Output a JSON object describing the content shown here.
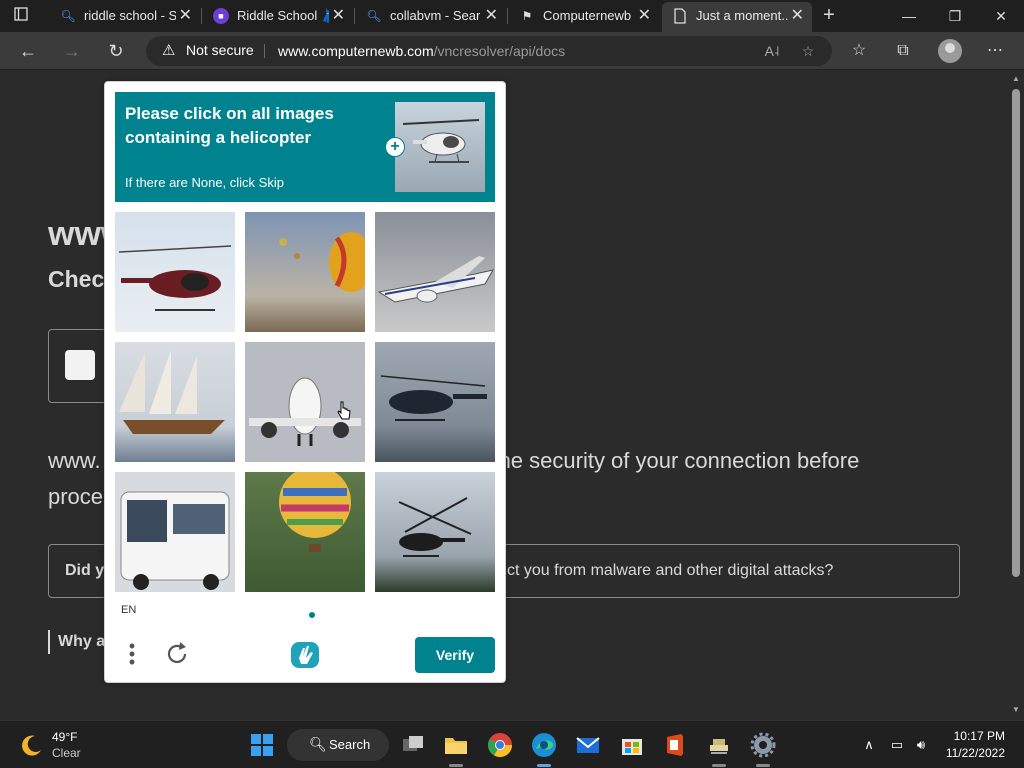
{
  "browser": {
    "tabs": [
      {
        "label": "riddle school - S",
        "icon": "search-icon"
      },
      {
        "label": "Riddle School 👗",
        "icon": "twitch-icon"
      },
      {
        "label": "collabvm - Sear",
        "icon": "search-icon"
      },
      {
        "label": "Computernewb",
        "icon": "computernewb-icon"
      },
      {
        "label": "Just a moment...",
        "icon": "page-icon"
      }
    ],
    "security_label": "Not secure",
    "url_host": "www.computernewb.com",
    "url_path": "/vncresolver/api/docs"
  },
  "page": {
    "site_title": "www.",
    "check_text": "Check",
    "body_start": "www.",
    "body_mid": "he security of your connection before",
    "body_end": "proce",
    "info_question": "Did y",
    "info_tail": "ct you from malware and other digital attacks?",
    "why_label": "Why a"
  },
  "captcha": {
    "prompt_line": "Please click on all images containing a helicopter",
    "prompt_sub": "If there are None, click Skip",
    "language": "EN",
    "verify_label": "Verify",
    "images": [
      {
        "subject": "helicopter"
      },
      {
        "subject": "hot-air-balloon"
      },
      {
        "subject": "airplane"
      },
      {
        "subject": "sailboat"
      },
      {
        "subject": "airplane"
      },
      {
        "subject": "helicopter"
      },
      {
        "subject": "bus"
      },
      {
        "subject": "hot-air-balloon"
      },
      {
        "subject": "helicopter"
      }
    ],
    "accent_color": "#00838f"
  },
  "taskbar": {
    "temperature": "49°F",
    "condition": "Clear",
    "search_label": "Search",
    "time": "10:17 PM",
    "date": "11/22/2022"
  }
}
